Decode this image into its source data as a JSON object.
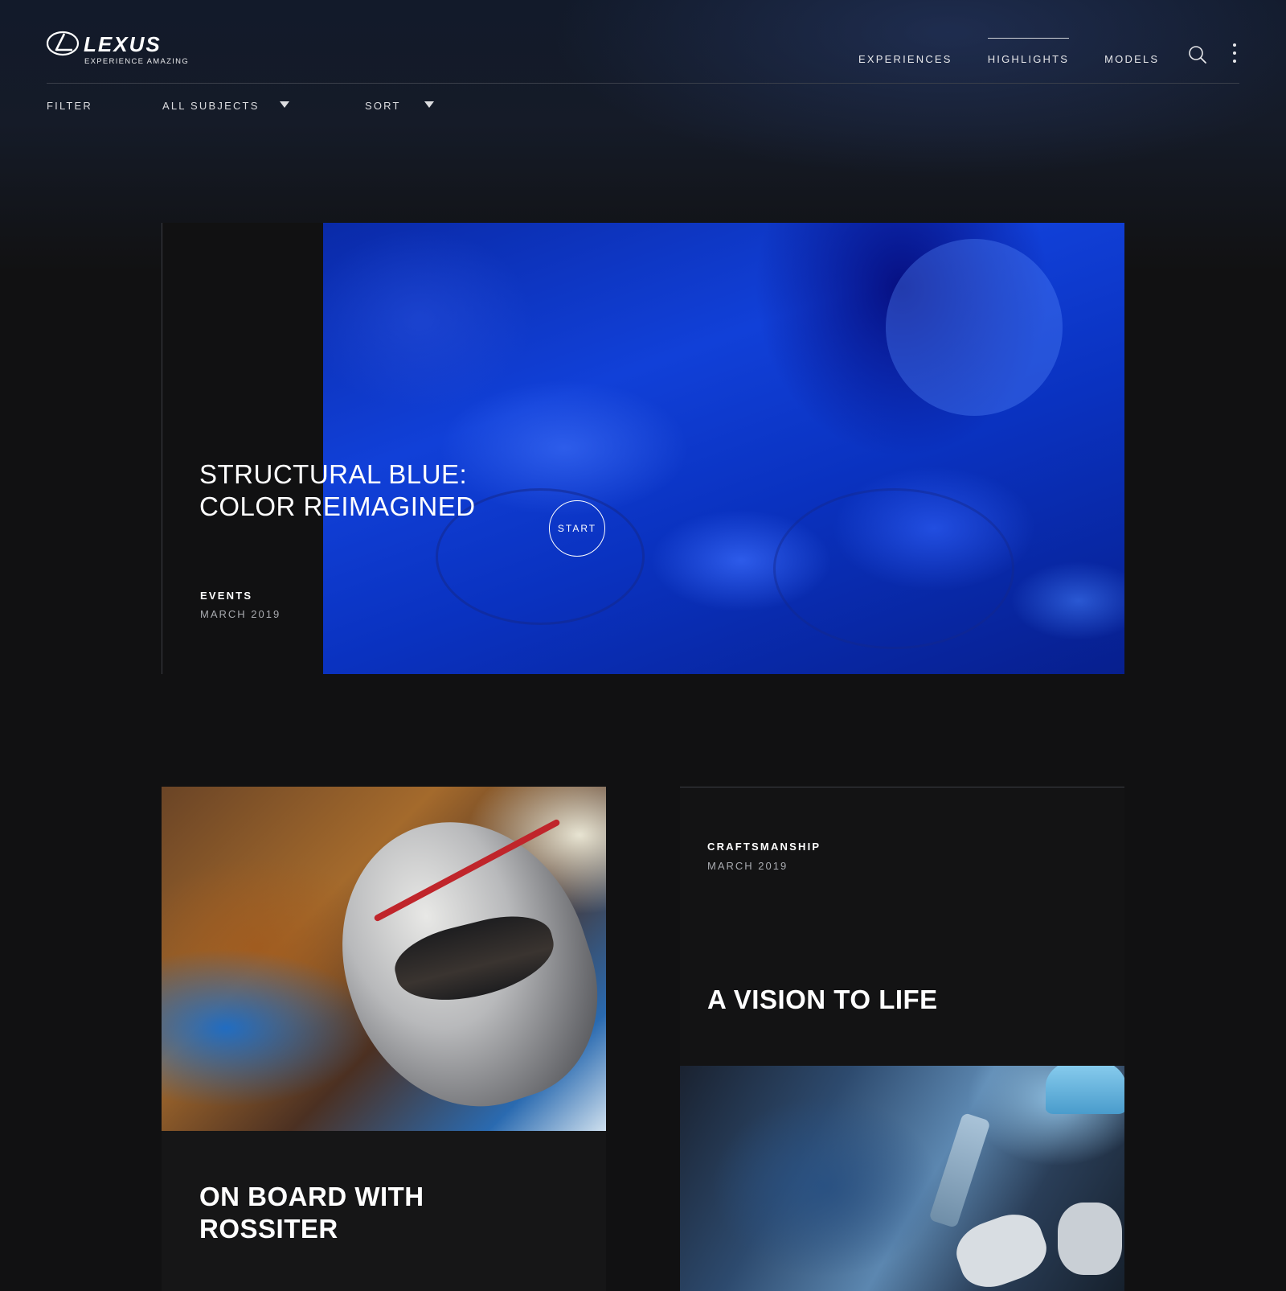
{
  "header": {
    "brand": "LEXUS",
    "tagline": "EXPERIENCE AMAZING",
    "nav": [
      {
        "label": "EXPERIENCES",
        "active": false
      },
      {
        "label": "HIGHLIGHTS",
        "active": true
      },
      {
        "label": "MODELS",
        "active": false
      }
    ],
    "icons": {
      "search": "search-icon",
      "more": "more-vertical-icon"
    }
  },
  "filter_bar": {
    "filter_label": "FILTER",
    "subject_value": "ALL SUBJECTS",
    "sort_label": "SORT"
  },
  "feature": {
    "title_line1": "STRUCTURAL BLUE:",
    "title_line2": "COLOR REIMAGINED",
    "start_label": "START",
    "category": "EVENTS",
    "date": "MARCH 2019"
  },
  "cards": [
    {
      "title_line1": "ON BOARD WITH",
      "title_line2": "ROSSITER"
    },
    {
      "category": "CRAFTSMANSHIP",
      "date": "MARCH 2019",
      "title": "A VISION TO LIFE"
    }
  ],
  "colors": {
    "background": "#111112",
    "accent_blue": "#1140d8",
    "text_muted": "#a9abb0"
  }
}
